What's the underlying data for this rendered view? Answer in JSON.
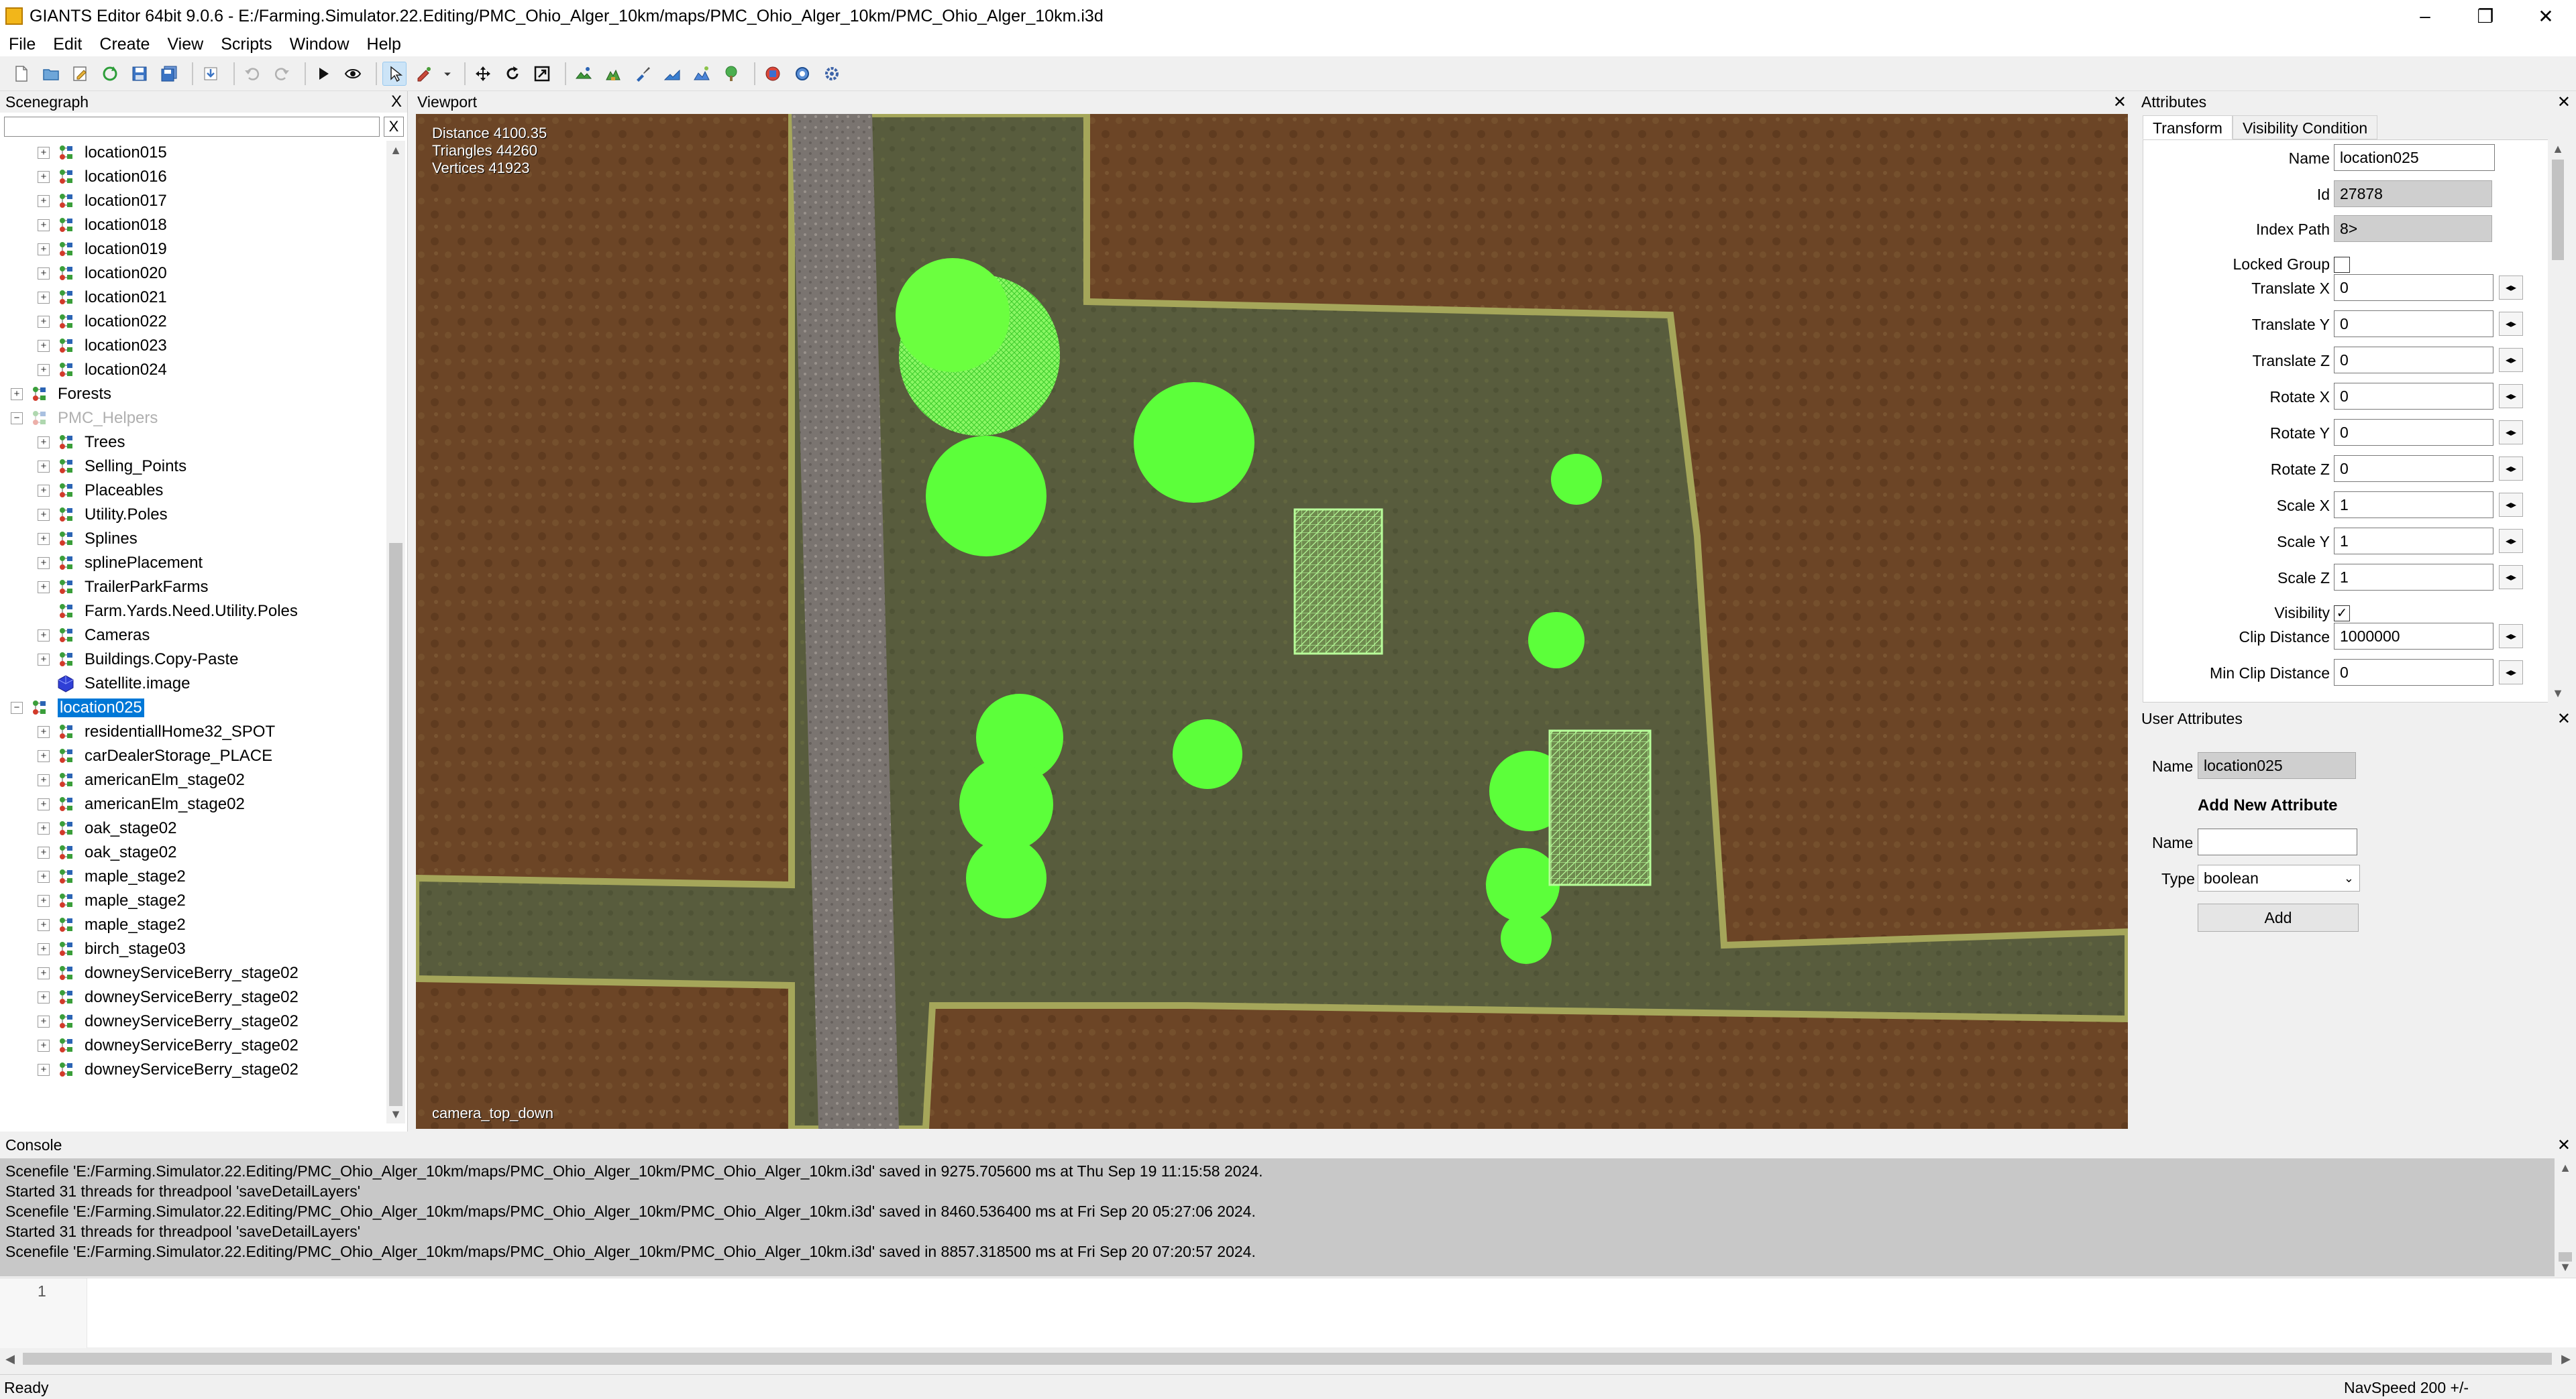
{
  "window": {
    "title": "GIANTS Editor 64bit 9.0.6 - E:/Farming.Simulator.22.Editing/PMC_Ohio_Alger_10km/maps/PMC_Ohio_Alger_10km/PMC_Ohio_Alger_10km.i3d",
    "minimize": "–",
    "maximize": "❐",
    "close": "✕"
  },
  "menu": [
    "File",
    "Edit",
    "Create",
    "View",
    "Scripts",
    "Window",
    "Help"
  ],
  "toolbar": {
    "icons": [
      "new-file-icon",
      "open-folder-icon",
      "edit-icon",
      "refresh-icon",
      "save-icon",
      "save-all-icon",
      "import-icon",
      "undo-icon",
      "redo-icon",
      "play-icon",
      "eye-icon",
      "select-icon",
      "paint-icon",
      "dropdown-arrow-icon",
      "move-icon",
      "rotate-icon",
      "scale-icon",
      "terrain-icon",
      "foliage-icon",
      "paint-brush-icon",
      "terrain-paint-icon",
      "terrain-sculpt-icon",
      "tree-icon",
      "material-icon",
      "settings-icon",
      "gear-icon"
    ]
  },
  "scenegraph": {
    "header": "Scenegraph",
    "close": "X",
    "search_placeholder": "",
    "clear": "X",
    "rows": [
      {
        "label": "location015",
        "depth": 1,
        "expander": "+",
        "state": "normal"
      },
      {
        "label": "location016",
        "depth": 1,
        "expander": "+",
        "state": "normal"
      },
      {
        "label": "location017",
        "depth": 1,
        "expander": "+",
        "state": "normal"
      },
      {
        "label": "location018",
        "depth": 1,
        "expander": "+",
        "state": "normal"
      },
      {
        "label": "location019",
        "depth": 1,
        "expander": "+",
        "state": "normal"
      },
      {
        "label": "location020",
        "depth": 1,
        "expander": "+",
        "state": "normal"
      },
      {
        "label": "location021",
        "depth": 1,
        "expander": "+",
        "state": "normal"
      },
      {
        "label": "location022",
        "depth": 1,
        "expander": "+",
        "state": "normal"
      },
      {
        "label": "location023",
        "depth": 1,
        "expander": "+",
        "state": "normal"
      },
      {
        "label": "location024",
        "depth": 1,
        "expander": "+",
        "state": "normal"
      },
      {
        "label": "Forests",
        "depth": 0,
        "expander": "+",
        "state": "normal"
      },
      {
        "label": "PMC_Helpers",
        "depth": 0,
        "expander": "−",
        "state": "dim"
      },
      {
        "label": "Trees",
        "depth": 1,
        "expander": "+",
        "state": "normal"
      },
      {
        "label": "Selling_Points",
        "depth": 1,
        "expander": "+",
        "state": "normal"
      },
      {
        "label": "Placeables",
        "depth": 1,
        "expander": "+",
        "state": "normal"
      },
      {
        "label": "Utility.Poles",
        "depth": 1,
        "expander": "+",
        "state": "normal"
      },
      {
        "label": "Splines",
        "depth": 1,
        "expander": "+",
        "state": "normal"
      },
      {
        "label": "splinePlacement",
        "depth": 1,
        "expander": "+",
        "state": "normal"
      },
      {
        "label": "TrailerParkFarms",
        "depth": 1,
        "expander": "+",
        "state": "normal"
      },
      {
        "label": "Farm.Yards.Need.Utility.Poles",
        "depth": 1,
        "expander": "",
        "state": "normal"
      },
      {
        "label": "Cameras",
        "depth": 1,
        "expander": "+",
        "state": "normal"
      },
      {
        "label": "Buildings.Copy-Paste",
        "depth": 1,
        "expander": "+",
        "state": "normal"
      },
      {
        "label": "Satellite.image",
        "depth": 1,
        "expander": "",
        "state": "shape"
      },
      {
        "label": "location025",
        "depth": 0,
        "expander": "−",
        "state": "selected"
      },
      {
        "label": "residentiallHome32_SPOT",
        "depth": 1,
        "expander": "+",
        "state": "normal"
      },
      {
        "label": "carDealerStorage_PLACE",
        "depth": 1,
        "expander": "+",
        "state": "normal"
      },
      {
        "label": "americanElm_stage02",
        "depth": 1,
        "expander": "+",
        "state": "normal"
      },
      {
        "label": "americanElm_stage02",
        "depth": 1,
        "expander": "+",
        "state": "normal"
      },
      {
        "label": "oak_stage02",
        "depth": 1,
        "expander": "+",
        "state": "normal"
      },
      {
        "label": "oak_stage02",
        "depth": 1,
        "expander": "+",
        "state": "normal"
      },
      {
        "label": "maple_stage2",
        "depth": 1,
        "expander": "+",
        "state": "normal"
      },
      {
        "label": "maple_stage2",
        "depth": 1,
        "expander": "+",
        "state": "normal"
      },
      {
        "label": "maple_stage2",
        "depth": 1,
        "expander": "+",
        "state": "normal"
      },
      {
        "label": "birch_stage03",
        "depth": 1,
        "expander": "+",
        "state": "normal"
      },
      {
        "label": "downeyServiceBerry_stage02",
        "depth": 1,
        "expander": "+",
        "state": "normal"
      },
      {
        "label": "downeyServiceBerry_stage02",
        "depth": 1,
        "expander": "+",
        "state": "normal"
      },
      {
        "label": "downeyServiceBerry_stage02",
        "depth": 1,
        "expander": "+",
        "state": "normal"
      },
      {
        "label": "downeyServiceBerry_stage02",
        "depth": 1,
        "expander": "+",
        "state": "normal"
      },
      {
        "label": "downeyServiceBerry_stage02",
        "depth": 1,
        "expander": "+",
        "state": "normal"
      }
    ]
  },
  "viewport": {
    "header": "Viewport",
    "close": "✕",
    "stats": [
      "Distance 4100.35",
      "Triangles 44260",
      "Vertices 41923"
    ],
    "camera": "camera_top_down"
  },
  "attributes": {
    "header": "Attributes",
    "close": "✕",
    "tabs": [
      "Transform",
      "Visibility Condition"
    ],
    "fields": [
      {
        "label": "Name",
        "value": "location025",
        "kind": "text"
      },
      {
        "label": "Id",
        "value": "27878",
        "kind": "readonly"
      },
      {
        "label": "Index Path",
        "value": "8>",
        "kind": "readonly"
      },
      {
        "label": "Locked Group",
        "value": "",
        "kind": "checkbox"
      },
      {
        "label": "Translate X",
        "value": "0",
        "kind": "spin"
      },
      {
        "label": "Translate Y",
        "value": "0",
        "kind": "spin"
      },
      {
        "label": "Translate Z",
        "value": "0",
        "kind": "spin"
      },
      {
        "label": "Rotate X",
        "value": "0",
        "kind": "spin"
      },
      {
        "label": "Rotate Y",
        "value": "0",
        "kind": "spin"
      },
      {
        "label": "Rotate Z",
        "value": "0",
        "kind": "spin"
      },
      {
        "label": "Scale X",
        "value": "1",
        "kind": "spin"
      },
      {
        "label": "Scale Y",
        "value": "1",
        "kind": "spin"
      },
      {
        "label": "Scale Z",
        "value": "1",
        "kind": "spin"
      },
      {
        "label": "Visibility",
        "value": "✓",
        "kind": "checkbox"
      },
      {
        "label": "Clip Distance",
        "value": "1000000",
        "kind": "spin"
      },
      {
        "label": "Min Clip Distance",
        "value": "0",
        "kind": "spin"
      }
    ]
  },
  "user_attributes": {
    "header": "User Attributes",
    "close": "✕",
    "name_label": "Name",
    "name_value": "location025",
    "add_heading": "Add New Attribute",
    "new_name_label": "Name",
    "new_name_value": "",
    "type_label": "Type",
    "type_value": "boolean",
    "add_button": "Add"
  },
  "console": {
    "header": "Console",
    "close": "✕",
    "lines": [
      "Scenefile 'E:/Farming.Simulator.22.Editing/PMC_Ohio_Alger_10km/maps/PMC_Ohio_Alger_10km/PMC_Ohio_Alger_10km.i3d' saved in 9275.705600 ms at Thu Sep 19 11:15:58 2024.",
      "Started 31 threads for threadpool 'saveDetailLayers'",
      "Scenefile 'E:/Farming.Simulator.22.Editing/PMC_Ohio_Alger_10km/maps/PMC_Ohio_Alger_10km/PMC_Ohio_Alger_10km.i3d' saved in 8460.536400 ms at Fri Sep 20 05:27:06 2024.",
      "Started 31 threads for threadpool 'saveDetailLayers'",
      "Scenefile 'E:/Farming.Simulator.22.Editing/PMC_Ohio_Alger_10km/maps/PMC_Ohio_Alger_10km/PMC_Ohio_Alger_10km.i3d' saved in 8857.318500 ms at Fri Sep 20 07:20:57 2024."
    ],
    "line_number": "1",
    "script_text": ""
  },
  "status": {
    "left": "Ready",
    "right": "NavSpeed 200 +/-"
  },
  "colors": {
    "selection": "#0078d7",
    "foliage": "#5cff3a",
    "grass": "#5b5f3f",
    "soil": "#6a4424",
    "road": "#7b7570"
  }
}
